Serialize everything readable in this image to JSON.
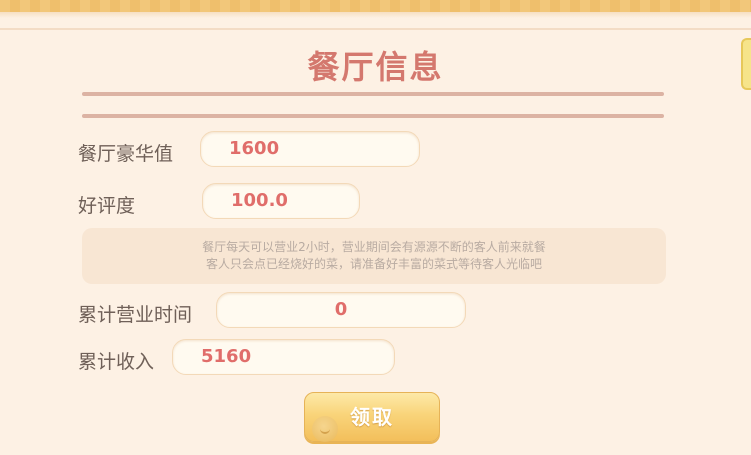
{
  "title": "餐厅信息",
  "stats": {
    "luxury_label": "餐厅豪华值",
    "luxury_value": "1600",
    "rating_label": "好评度",
    "rating_value": "100.0"
  },
  "notice": {
    "line1": "餐厅每天可以营业2小时，营业期间会有源源不断的客人前来就餐",
    "line2": "客人只会点已经烧好的菜，请准备好丰富的菜式等待客人光临吧"
  },
  "totals": {
    "hours_label": "累计营业时间",
    "hours_value": "0",
    "income_label": "累计收入",
    "income_value": "5160"
  },
  "claim_button": {
    "label": "领取"
  },
  "icons": {
    "button_decoration": "coin-icon"
  },
  "colors": {
    "value_text": "#e06d6a",
    "title_text": "#d4786e",
    "button_gold": "#f9d47a"
  }
}
